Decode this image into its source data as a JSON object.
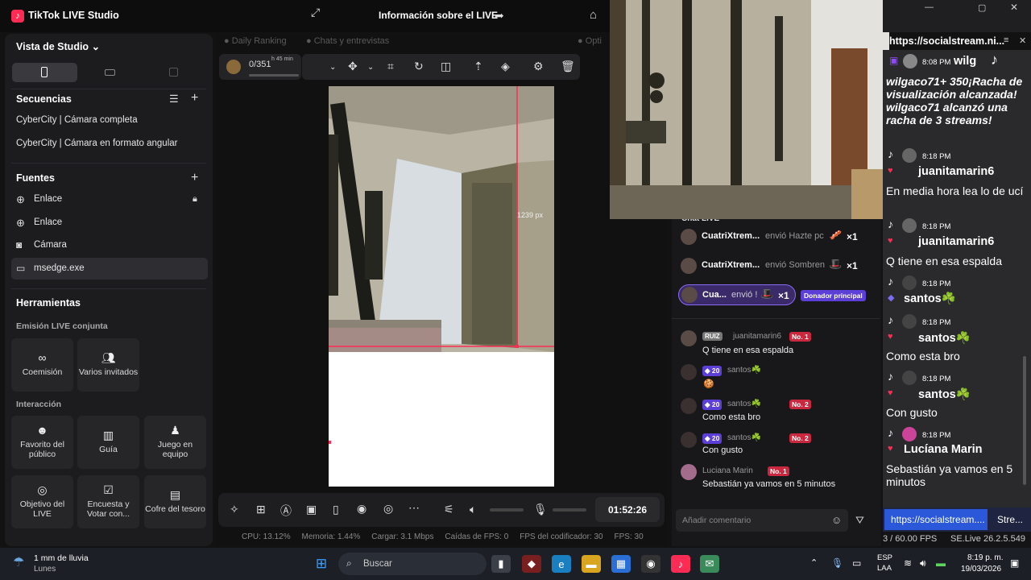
{
  "app": {
    "title": "TikTok LIVE Studio",
    "live_info": "Información sobre el LIVE"
  },
  "left": {
    "studio_view": "Vista de Studio",
    "sequences_title": "Secuencias",
    "sequences": [
      "CyberCity | Cámara completa",
      "CyberCity | Cámara en formato angular"
    ],
    "sources_title": "Fuentes",
    "sources": [
      "Enlace",
      "Enlace",
      "Cámara",
      "msedge.exe"
    ],
    "tools_title": "Herramientas",
    "joint_title": "Emisión LIVE conjunta",
    "joint_tools": [
      "Coemisión",
      "Varios invitados"
    ],
    "interaction_title": "Interacción",
    "interaction_tools": [
      "Favorito del público",
      "Guía",
      "Juego en equipo",
      "Objetivo del LIVE",
      "Encuesta y Votar con...",
      "Cofre del tesoro"
    ]
  },
  "center": {
    "tabs": [
      "Daily Ranking",
      "Chats y entrevistas",
      "Opti"
    ],
    "ranking_progress": "0/351",
    "ranking_time": "h 45 min",
    "ranking_progress_fraction": 0,
    "dimension_label": "1239 px",
    "timer": "01:52:26",
    "stats": {
      "cpu": "CPU: 13.12%",
      "memory": "Memoria: 1.44%",
      "upload": "Cargar: 3.1 Mbps",
      "fps_drops": "Caídas de FPS: 0",
      "encoder_fps": "FPS del codificador: 30",
      "fps": "FPS: 30"
    }
  },
  "chat_live": {
    "title": "Chat LIVE",
    "gifts": [
      {
        "name": "CuatriXtrem...",
        "text": "envió Hazte pc",
        "count": "×1"
      },
      {
        "name": "CuatriXtrem...",
        "text": "envió Sombren",
        "count": "×1"
      },
      {
        "name": "Cua...",
        "text": "envió !",
        "count": "×1",
        "badge": "Donador principal"
      }
    ],
    "messages": [
      {
        "badge": "RUIZ",
        "user": "juanitamarin6",
        "rank": "No. 1",
        "text": "Q tiene en esa espalda"
      },
      {
        "level": "20",
        "user": "santos☘️",
        "text": ""
      },
      {
        "level": "20",
        "user": "santos☘️",
        "rank": "No. 2",
        "text": "Como esta bro"
      },
      {
        "level": "20",
        "user": "santos☘️",
        "rank": "No. 2",
        "text": "Con gusto"
      },
      {
        "user": "Luciana Marin",
        "rank": "No. 1",
        "text": "Sebastián ya vamos en 5 minutos"
      }
    ],
    "comment_placeholder": "Añadir comentario"
  },
  "social_stream": {
    "url": "https://socialstream.ni...",
    "partial_top": {
      "time": "8:08 PM",
      "name": "wilg",
      "text": "wilgaco71+ 350¡Racha de visualización alcanzada! wilgaco71 alcanzó una racha de 3 streams!"
    },
    "messages": [
      {
        "time": "8:18 PM",
        "name": "juanitamarin6",
        "text": "En media hora lea lo de ucí"
      },
      {
        "time": "8:18 PM",
        "name": "juanitamarin6",
        "text": "Q tiene en esa espalda"
      },
      {
        "time": "8:18 PM",
        "name": "santos☘️",
        "text": ""
      },
      {
        "time": "8:18 PM",
        "name": "santos☘️",
        "text": "Como esta bro"
      },
      {
        "time": "8:18 PM",
        "name": "santos☘️",
        "text": "Con gusto"
      },
      {
        "time": "8:18 PM",
        "name": "Lucíana Marin",
        "text": "Sebastián ya vamos en 5 minutos"
      }
    ],
    "tab_url": "https://socialstream....",
    "tab_other": "Stre...",
    "fps_status": "3 / 60.00 FPS",
    "version": "SE.Live 26.2.5.549"
  },
  "taskbar": {
    "weather": "1 mm de lluvia",
    "weather_day": "Lunes",
    "search": "Buscar",
    "lang": "ESP",
    "lang2": "LAA",
    "time": "8:19 p. m.",
    "date": "19/03/2026"
  },
  "colors": {
    "accent": "#fe2c55",
    "purple": "#5b3fd6",
    "bg": "#121212"
  }
}
